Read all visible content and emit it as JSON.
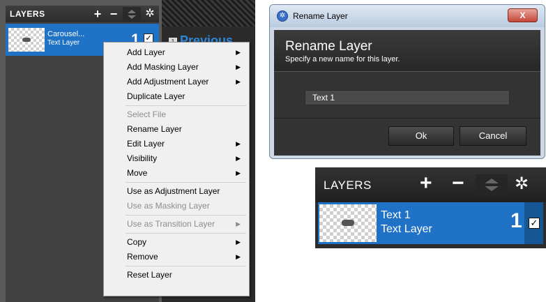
{
  "left_panel": {
    "title": "LAYERS",
    "plus_glyph": "+",
    "minus_glyph": "−",
    "gear_glyph": "✲",
    "layer": {
      "name": "Carousel...",
      "type": "Text Layer",
      "number": "1",
      "checked": "✓"
    },
    "previous_badge": "1",
    "previous_label": "Previous"
  },
  "context_menu": {
    "items": [
      {
        "label": "Add Layer",
        "submenu": true,
        "disabled": false
      },
      {
        "label": "Add Masking Layer",
        "submenu": true,
        "disabled": false
      },
      {
        "label": "Add Adjustment Layer",
        "submenu": true,
        "disabled": false
      },
      {
        "label": "Duplicate Layer",
        "submenu": false,
        "disabled": false
      },
      {
        "label": "Select File",
        "submenu": false,
        "disabled": true
      },
      {
        "label": "Rename Layer",
        "submenu": false,
        "disabled": false
      },
      {
        "label": "Edit Layer",
        "submenu": true,
        "disabled": false
      },
      {
        "label": "Visibility",
        "submenu": true,
        "disabled": false
      },
      {
        "label": "Move",
        "submenu": true,
        "disabled": false
      },
      {
        "label": "Use as Adjustment Layer",
        "submenu": false,
        "disabled": false
      },
      {
        "label": "Use as Masking Layer",
        "submenu": false,
        "disabled": true
      },
      {
        "label": "Use as Transition Layer",
        "submenu": true,
        "disabled": true
      },
      {
        "label": "Copy",
        "submenu": true,
        "disabled": false
      },
      {
        "label": "Remove",
        "submenu": true,
        "disabled": false
      },
      {
        "label": "Reset Layer",
        "submenu": false,
        "disabled": false
      }
    ],
    "arrow_glyph": "▶"
  },
  "dialog": {
    "window_title": "Rename Layer",
    "close_glyph": "X",
    "heading": "Rename Layer",
    "subtitle": "Specify a new name for this layer.",
    "input_value": "Text 1",
    "ok_label": "Ok",
    "cancel_label": "Cancel"
  },
  "right_panel": {
    "title": "LAYERS",
    "plus_glyph": "+",
    "minus_glyph": "−",
    "gear_glyph": "✲",
    "layer": {
      "name": "Text 1",
      "type": "Text Layer",
      "number": "1",
      "checked": "✓"
    }
  },
  "colors": {
    "selection_blue": "#1f72c6",
    "panel_dark": "#2c2c2c",
    "menu_bg": "#f0f0f0"
  }
}
